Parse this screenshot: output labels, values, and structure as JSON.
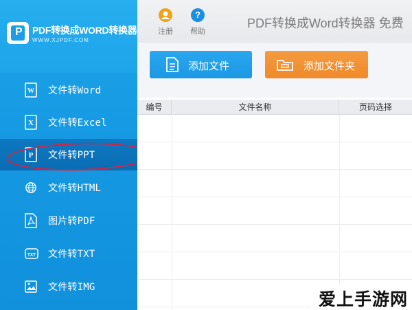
{
  "logo": {
    "title": "PDF转换成WORD转换器",
    "url": "WWW.XJPDF.COM"
  },
  "sidebar": {
    "items": [
      {
        "label": "文件转Word",
        "icon": "word-file-icon"
      },
      {
        "label": "文件转Excel",
        "icon": "excel-file-icon"
      },
      {
        "label": "文件转PPT",
        "icon": "ppt-file-icon"
      },
      {
        "label": "文件转HTML",
        "icon": "globe-icon"
      },
      {
        "label": "图片转PDF",
        "icon": "pdf-file-icon"
      },
      {
        "label": "文件转TXT",
        "icon": "txt-file-icon"
      },
      {
        "label": "文件转IMG",
        "icon": "image-file-icon"
      }
    ],
    "active_index": 2
  },
  "topbar": {
    "register_label": "注册",
    "help_label": "帮助",
    "help_glyph": "?",
    "app_title": "PDF转换成Word转换器 免费"
  },
  "actions": {
    "add_file": "添加文件",
    "add_folder": "添加文件夹"
  },
  "table": {
    "columns": [
      "编号",
      "文件名称",
      "页码选择"
    ],
    "rows": []
  },
  "watermark": "爱上手游网",
  "colors": {
    "sidebar_blue": "#169ae3",
    "active_item": "#0a6db4",
    "button_blue": "#1b98e4",
    "button_orange": "#ef8a2a",
    "highlight_red": "#e0203a"
  }
}
